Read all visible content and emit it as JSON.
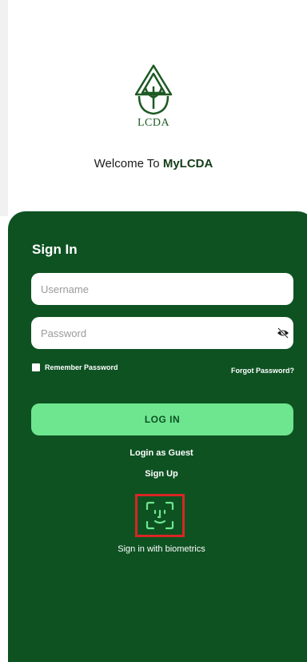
{
  "logo": {
    "text": "LCDA"
  },
  "welcome": {
    "prefix": "Welcome To ",
    "brand": "MyLCDA"
  },
  "signin": {
    "title": "Sign In",
    "username_placeholder": "Username",
    "password_placeholder": "Password",
    "remember_label": "Remember Password",
    "forgot_label": "Forgot Password?",
    "login_label": "LOG IN",
    "guest_label": "Login as Guest",
    "signup_label": "Sign Up",
    "biometrics_label": "Sign in with biometrics"
  },
  "colors": {
    "brand_green": "#0e5222",
    "button_green": "#6ee690",
    "highlight_red": "#d92525"
  },
  "icons": [
    "lcda-logo-icon",
    "eye-off-icon",
    "face-id-icon"
  ]
}
